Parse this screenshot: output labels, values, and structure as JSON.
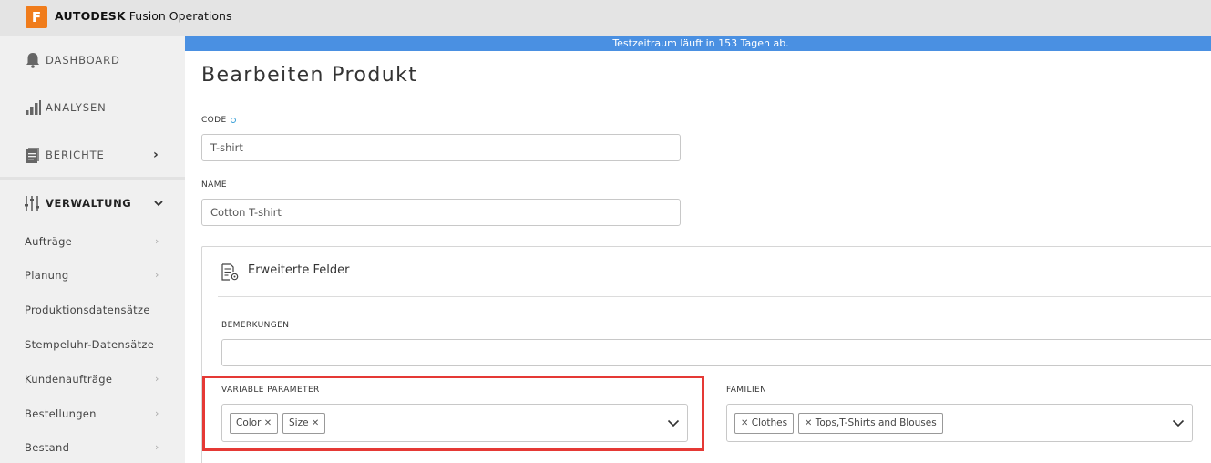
{
  "app": {
    "logo_letter": "F",
    "brand_bold": "AUTODESK",
    "brand_rest": "Fusion Operations"
  },
  "sidebar": {
    "main_items": [
      {
        "label": "DASHBOARD",
        "icon": "bell-icon"
      },
      {
        "label": "ANALYSEN",
        "icon": "bar-chart-icon"
      },
      {
        "label": "BERICHTE",
        "icon": "document-stack-icon",
        "chevron": "›"
      },
      {
        "label": "VERWALTUNG",
        "icon": "sliders-icon",
        "chevron": "⌄",
        "active": true
      }
    ],
    "sub_items": [
      {
        "label": "Aufträge",
        "chevron": "›"
      },
      {
        "label": "Planung",
        "chevron": "›"
      },
      {
        "label": "Produktionsdatensätze",
        "chevron": ""
      },
      {
        "label": "Stempeluhr-Datensätze",
        "chevron": ""
      },
      {
        "label": "Kundenaufträge",
        "chevron": "›"
      },
      {
        "label": "Bestellungen",
        "chevron": "›"
      },
      {
        "label": "Bestand",
        "chevron": "›"
      }
    ]
  },
  "banner": {
    "text": "Testzeitraum läuft in 153 Tagen ab."
  },
  "page": {
    "title": "Bearbeiten Produkt"
  },
  "form": {
    "code": {
      "label": "CODE",
      "value": "T-shirt"
    },
    "name": {
      "label": "NAME",
      "value": "Cotton T-shirt"
    },
    "extended": {
      "title": "Erweiterte Felder",
      "bemerkungen": {
        "label": "BEMERKUNGEN",
        "value": ""
      },
      "variable_parameter": {
        "label": "VARIABLE PARAMETER",
        "tags": [
          "Color",
          "Size"
        ]
      },
      "familien": {
        "label": "FAMILIEN",
        "tags": [
          "Clothes",
          "Tops,T-Shirts and Blouses"
        ]
      }
    }
  },
  "colors": {
    "accent": "#4a90e2",
    "brand": "#f07c1b",
    "highlight": "#e53935",
    "sidebar_bg": "#f0f0f0",
    "topbar_bg": "#e4e4e4"
  }
}
